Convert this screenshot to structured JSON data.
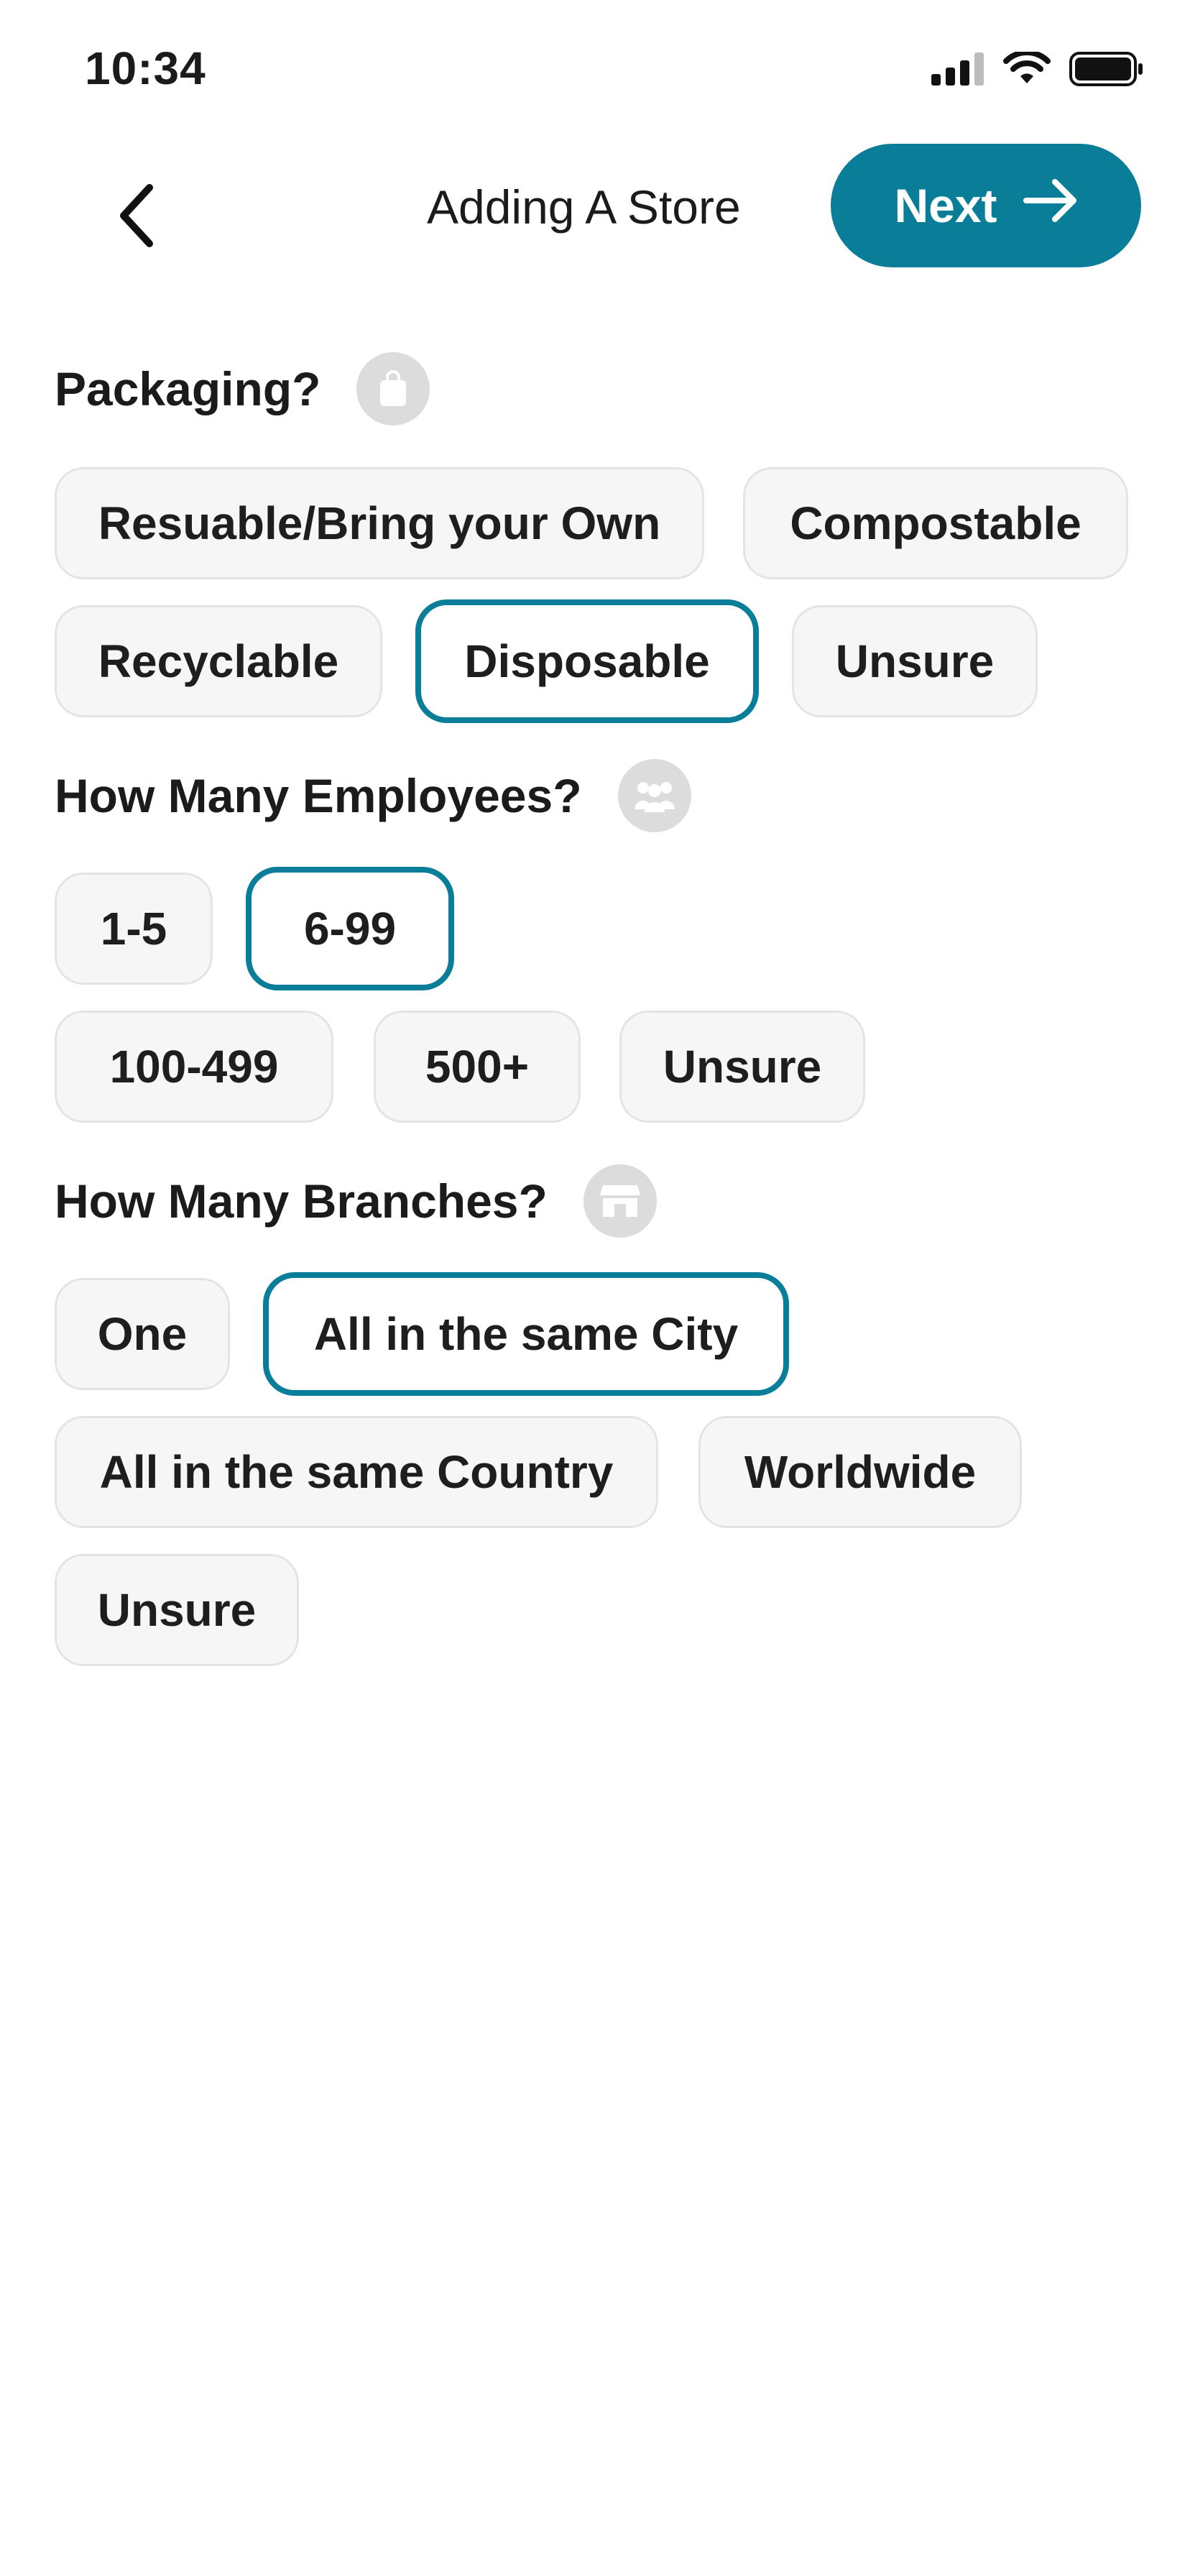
{
  "status_bar": {
    "time": "10:34"
  },
  "header": {
    "title": "Adding A Store",
    "next_label": "Next"
  },
  "colors": {
    "accent": "#0a7e98",
    "chip_bg": "#f6f6f6",
    "chip_border": "#e4e4e4",
    "icon_bg": "#dcdcdc"
  },
  "sections": {
    "packaging": {
      "title": "Packaging?",
      "icon": "shopping-bag-icon",
      "options": [
        "Resuable/Bring your Own",
        "Compostable",
        "Recyclable",
        "Disposable",
        "Unsure"
      ],
      "selected": "Disposable"
    },
    "employees": {
      "title": "How Many Employees?",
      "icon": "people-group-icon",
      "options": [
        "1-5",
        "6-99",
        "100-499",
        "500+",
        "Unsure"
      ],
      "selected": "6-99"
    },
    "branches": {
      "title": "How Many Branches?",
      "icon": "storefront-icon",
      "options": [
        "One",
        "All in the same City",
        "All in the same Country",
        "Worldwide",
        "Unsure"
      ],
      "selected": "All in the same City"
    }
  }
}
